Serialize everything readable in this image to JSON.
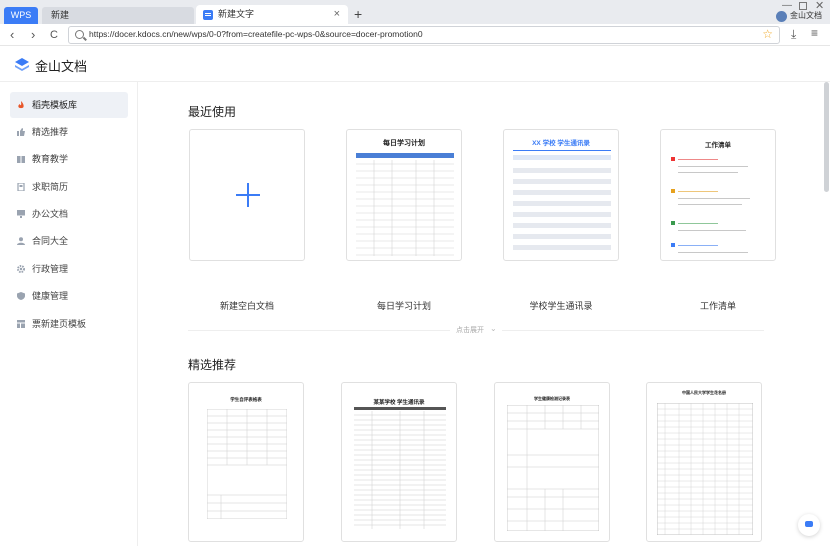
{
  "browser": {
    "tabs": [
      {
        "label": "WPS"
      },
      {
        "label": "新建"
      },
      {
        "label": "新建文字",
        "close": "×"
      }
    ],
    "new_tab": "+",
    "account_name": "金山文档",
    "url": "https://docer.kdocs.cn/new/wps/0-0?from=createfile-pc-wps-0&source=docer-promotion0",
    "nav_back": "‹",
    "nav_forward": "›",
    "nav_reload": "C"
  },
  "app": {
    "brand": "金山文档",
    "accent": "#3b7cf6"
  },
  "sidebar": {
    "items": [
      {
        "label": "稻壳模板库",
        "icon": "flame-icon"
      },
      {
        "label": "精选推荐",
        "icon": "thumbs-up-icon"
      },
      {
        "label": "教育教学",
        "icon": "book-icon"
      },
      {
        "label": "求职简历",
        "icon": "resume-icon"
      },
      {
        "label": "办公文档",
        "icon": "monitor-icon"
      },
      {
        "label": "合同大全",
        "icon": "person-icon"
      },
      {
        "label": "行政管理",
        "icon": "gear-icon"
      },
      {
        "label": "健康管理",
        "icon": "shield-icon"
      },
      {
        "label": "票新建页模板",
        "icon": "template-icon"
      }
    ]
  },
  "recent": {
    "title": "最近使用",
    "cards": [
      {
        "label": "新建空白文档"
      },
      {
        "label": "每日学习计划",
        "preview_title": "每日学习计划"
      },
      {
        "label": "学校学生通讯录",
        "preview_title": "XX 学校  学生通讯录"
      },
      {
        "label": "工作清单",
        "preview_title": "工作清单"
      }
    ],
    "expand": "点击展开"
  },
  "featured": {
    "title": "精选推荐",
    "cards": [
      {
        "preview_title": "学生自评表格表"
      },
      {
        "preview_title": "某某学校  学生通讯录"
      },
      {
        "preview_title": "学生健康检测记录表"
      },
      {
        "preview_title": "中国人民大学学生花名册"
      }
    ]
  }
}
